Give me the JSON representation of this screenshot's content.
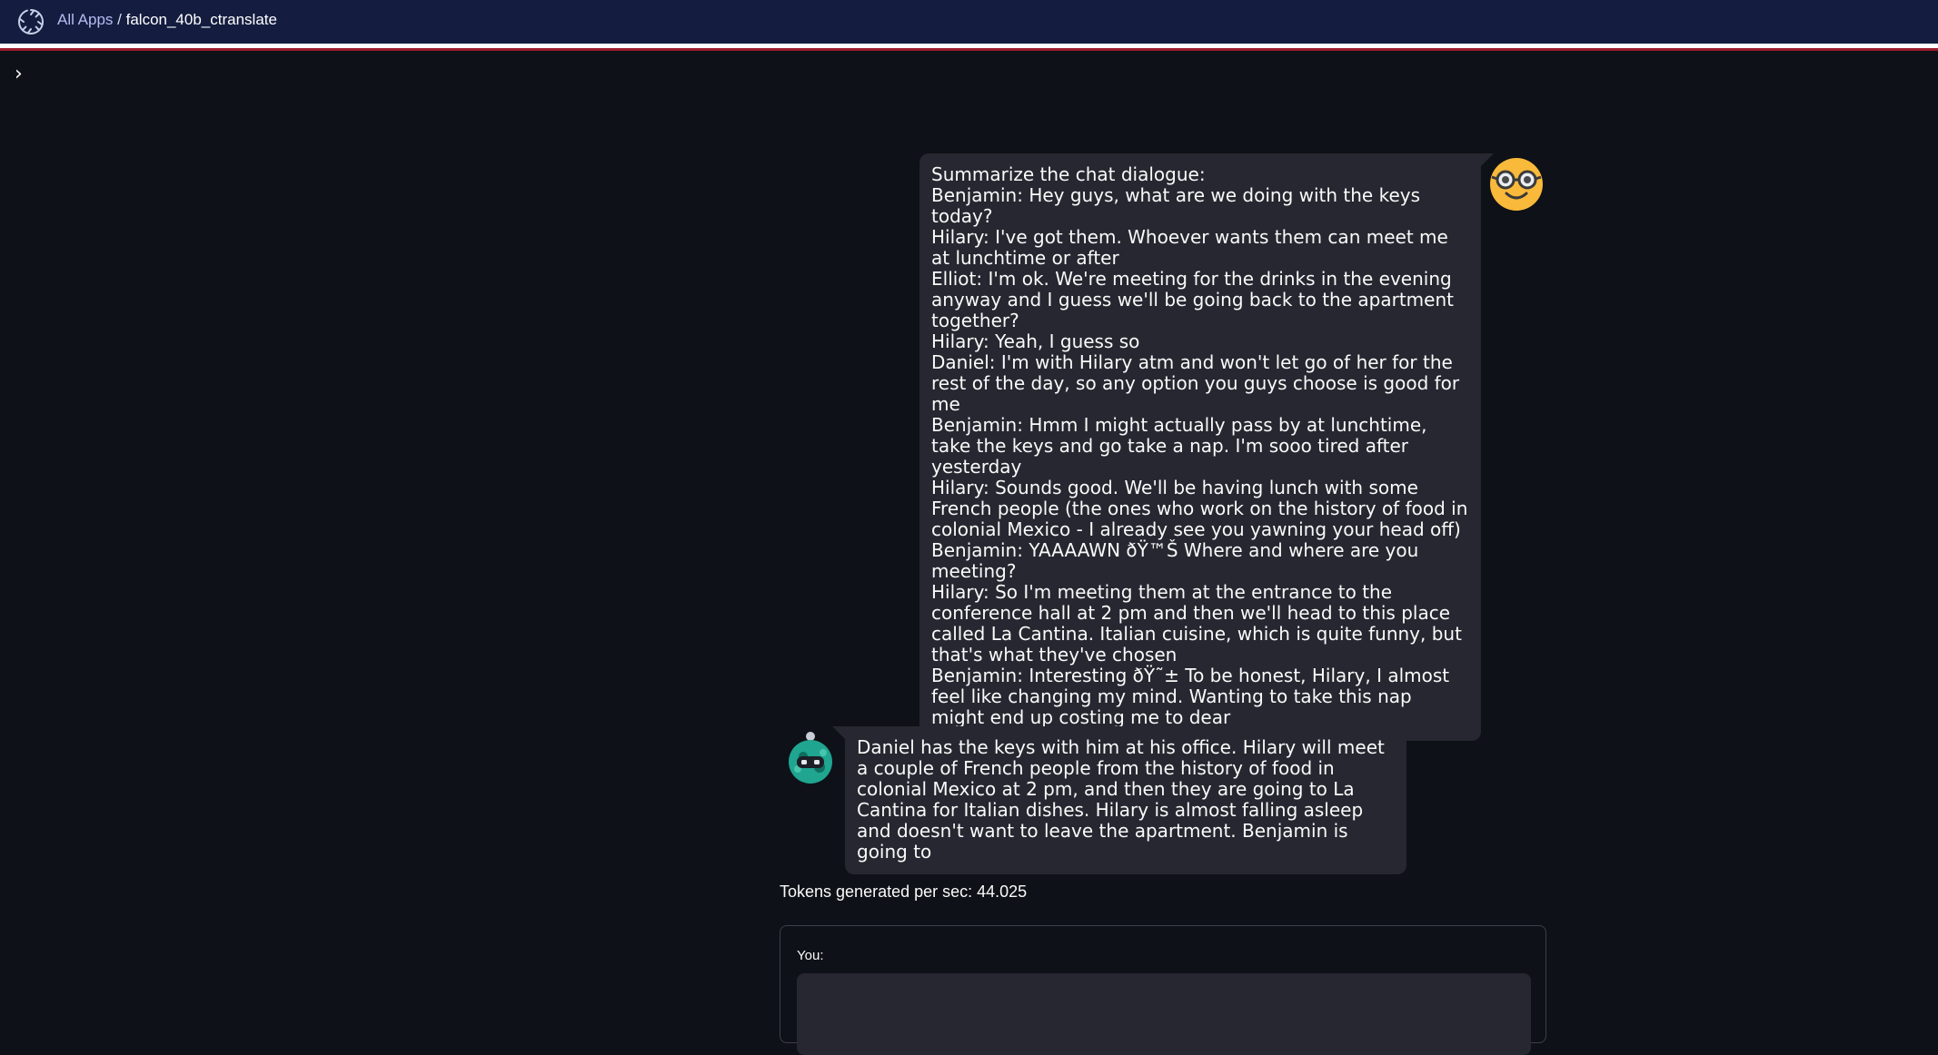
{
  "header": {
    "all_apps_label": "All Apps",
    "separator": " / ",
    "app_name": "falcon_40b_ctranslate"
  },
  "sidebar": {
    "toggle_glyph": "›"
  },
  "chat": {
    "user_message": "Summarize the chat dialogue:\nBenjamin: Hey guys, what are we doing with the keys today?\nHilary: I've got them. Whoever wants them can meet me at lunchtime or after\nElliot: I'm ok. We're meeting for the drinks in the evening anyway and I guess we'll be going back to the apartment together?\nHilary: Yeah, I guess so\nDaniel: I'm with Hilary atm and won't let go of her for the rest of the day, so any option you guys choose is good for me\nBenjamin: Hmm I might actually pass by at lunchtime, take the keys and go take a nap. I'm sooo tired after yesterday\nHilary: Sounds good. We'll be having lunch with some French people (the ones who work on the history of food in colonial Mexico - I already see you yawning your head off)\nBenjamin: YAAAAWN ðŸ™Š Where and where are you meeting?\nHilary: So I'm meeting them at the entrance to the conference hall at 2 pm and then we'll head to this place called La Cantina. Italian cuisine, which is quite funny, but that's what they've chosen\nBenjamin: Interesting ðŸ˜± To be honest, Hilary, I almost feel like changing my mind. Wanting to take this nap might end up costing me to dear",
    "bot_message": "Daniel has the keys with him at his office. Hilary will meet a couple of French people from the history of food in colonial Mexico at 2 pm, and then they are going to La Cantina for Italian dishes. Hilary is almost falling asleep and doesn't want to leave the apartment. Benjamin is going to",
    "user_avatar_icon": "nerd-face-icon",
    "bot_avatar_icon": "robot-icon"
  },
  "stats": {
    "tokens_text": "Tokens generated per sec: 44.025"
  },
  "form": {
    "input_label": "You:",
    "input_value": ""
  },
  "colors": {
    "background": "#0e1117",
    "header_bg": "#141d40",
    "bubble_bg": "#262730",
    "accent_red": "#9b1c2c",
    "avatar_yellow": "#f9b93a",
    "bot_teal": "#1fa590"
  }
}
